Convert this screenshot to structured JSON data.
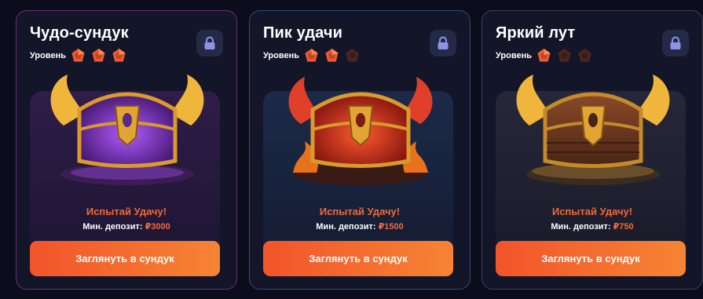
{
  "colors": {
    "background": "#0c0d1c",
    "card": "#131528",
    "accent": "#f2542a",
    "accent_end": "#f68435",
    "gem_active": "#e65b32",
    "gem_inactive": "#4a2620",
    "lock_bg": "#242a45",
    "lock_icon": "#8e93e8"
  },
  "cards": [
    {
      "title": "Чудо-сундук",
      "level_label": "Уровень",
      "level": 3,
      "level_max": 3,
      "lock_icon": "lock-icon",
      "chest_image": "purple-winged-chest",
      "promo": "Испытай Удачу!",
      "deposit_label": "Мин. депозит:",
      "deposit_amount": "₽3000",
      "button_label": "Заглянуть в сундук"
    },
    {
      "title": "Пик удачи",
      "level_label": "Уровень",
      "level": 2,
      "level_max": 3,
      "lock_icon": "lock-icon",
      "chest_image": "red-fire-chest",
      "promo": "Испытай Удачу!",
      "deposit_label": "Мин. депозит:",
      "deposit_amount": "₽1500",
      "button_label": "Заглянуть в сундук"
    },
    {
      "title": "Яркий лут",
      "level_label": "Уровень",
      "level": 1,
      "level_max": 3,
      "lock_icon": "lock-icon",
      "chest_image": "wooden-winged-chest",
      "promo": "Испытай Удачу!",
      "deposit_label": "Мин. депозит:",
      "deposit_amount": "₽750",
      "button_label": "Заглянуть в сундук"
    }
  ]
}
